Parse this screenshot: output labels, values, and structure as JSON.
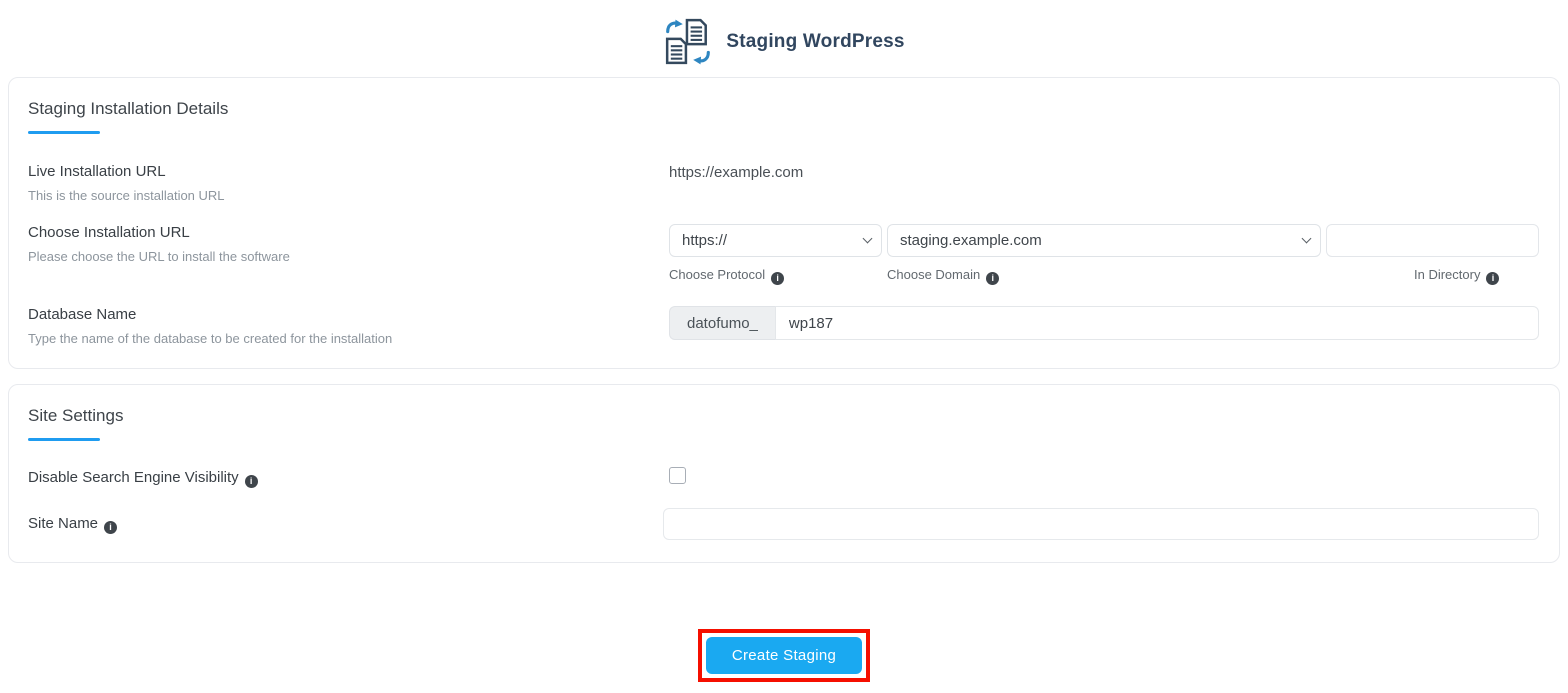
{
  "header": {
    "title": "Staging WordPress",
    "icon": "staging-copy-icon"
  },
  "colors": {
    "accent_blue": "#1f9cf0",
    "button_blue": "#1aa9f1",
    "highlight_red": "#f50f00",
    "title_navy": "#31465f",
    "icon_navy": "#34495e",
    "icon_arrow_blue": "#2e86c1"
  },
  "sections": {
    "installation": {
      "title": "Staging Installation Details",
      "rows": {
        "live_url": {
          "label": "Live Installation URL",
          "help": "This is the source installation URL",
          "value": "https://example.com"
        },
        "choose_url": {
          "label": "Choose Installation URL",
          "help": "Please choose the URL to install the software",
          "protocol": {
            "selected": "https://",
            "label": "Choose Protocol"
          },
          "domain": {
            "selected": "staging.example.com",
            "label": "Choose Domain"
          },
          "directory": {
            "value": "",
            "label": "In Directory"
          }
        },
        "database": {
          "label": "Database Name",
          "help": "Type the name of the database to be created for the installation",
          "prefix": "datofumo_",
          "value": "wp187"
        }
      }
    },
    "site_settings": {
      "title": "Site Settings",
      "rows": {
        "search_visibility": {
          "label": "Disable Search Engine Visibility",
          "checked": false
        },
        "site_name": {
          "label": "Site Name",
          "value": ""
        }
      }
    }
  },
  "footer": {
    "create_button_label": "Create Staging"
  }
}
